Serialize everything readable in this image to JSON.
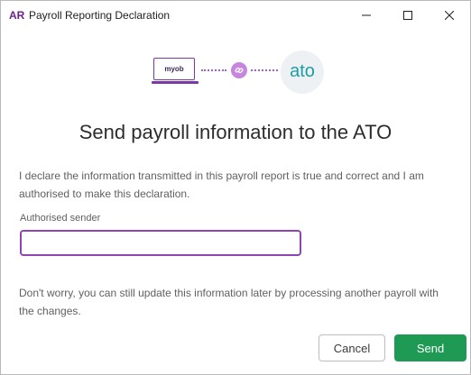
{
  "window": {
    "app_icon": "AR",
    "title": "Payroll Reporting Declaration",
    "controls": [
      "minimize-icon",
      "maximize-icon",
      "close-icon"
    ]
  },
  "logos": {
    "left_device_label": "myob",
    "link_icon": "link-icon",
    "right_logo_text": "ato"
  },
  "heading": "Send payroll information to the ATO",
  "declaration": "I declare the information transmitted in this payroll report is true and correct and I am authorised to make this declaration.",
  "form": {
    "label": "Authorised sender",
    "value": ""
  },
  "note": "Don't worry, you can still update this information later by processing another payroll with the changes.",
  "buttons": {
    "cancel": "Cancel",
    "send": "Send"
  },
  "colors": {
    "accent_purple": "#8f44b4",
    "send_green": "#1f9a54",
    "ato_teal": "#1d9ca7"
  }
}
